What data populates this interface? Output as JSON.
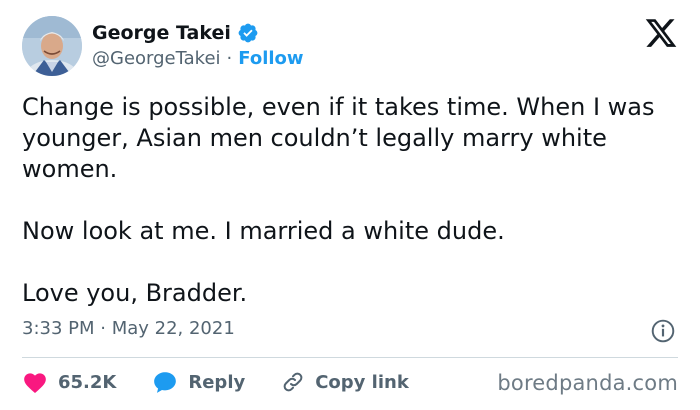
{
  "author": {
    "name": "George Takei",
    "handle": "@GeorgeTakei",
    "separator": "·",
    "follow_label": "Follow"
  },
  "tweet": {
    "paragraphs": [
      "Change is possible, even if it takes time. When I was younger, Asian men couldn’t legally marry white women.",
      "Now look at me. I married a white dude.",
      "Love you, Bradder."
    ],
    "timestamp": "3:33 PM · May 22, 2021"
  },
  "actions": {
    "likes": "65.2K",
    "reply_label": "Reply",
    "copy_link_label": "Copy link"
  },
  "watermark": "boredpanda.com",
  "colors": {
    "text": "#0f1419",
    "secondary": "#536471",
    "accent": "#1d9bf0",
    "like": "#f91880",
    "divider": "#cfd9de"
  },
  "icons": [
    "avatar",
    "verified-badge-icon",
    "x-logo-icon",
    "info-icon",
    "heart-icon",
    "reply-bubble-icon",
    "link-icon"
  ]
}
